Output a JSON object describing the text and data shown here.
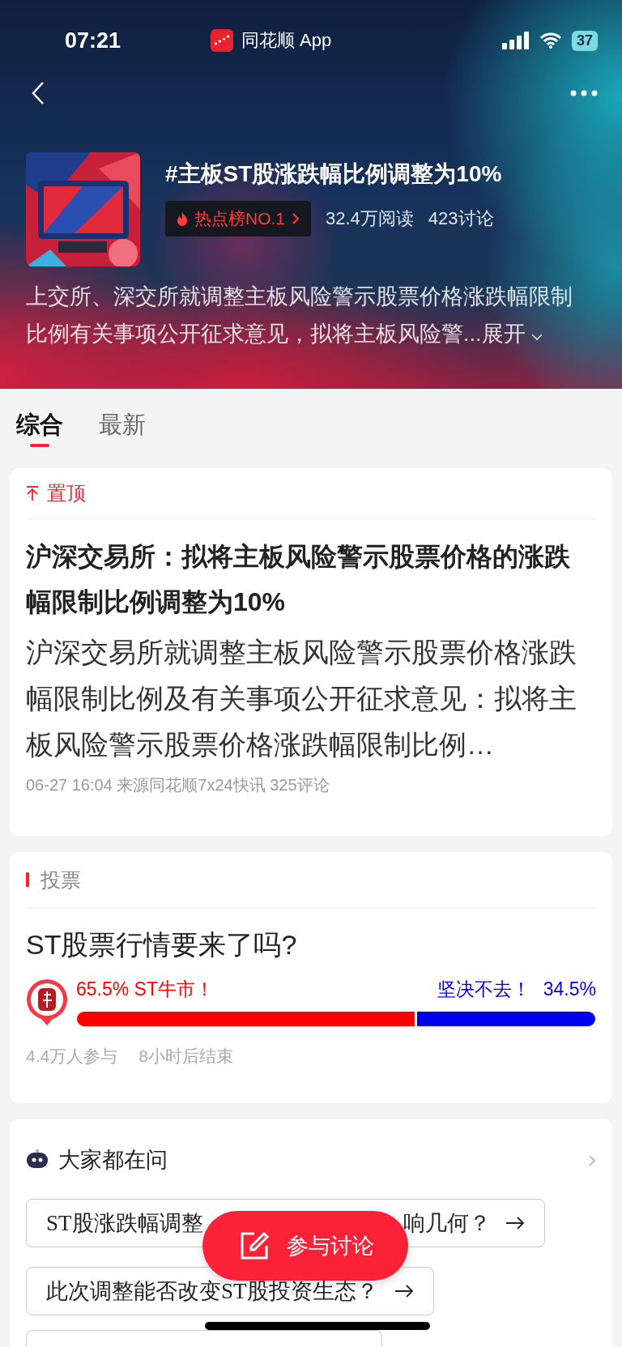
{
  "status_bar": {
    "time": "07:21",
    "app": "同花顺 App",
    "battery": "37"
  },
  "header": {
    "title": "#主板ST股涨跌幅比例调整为10%",
    "hot_badge": "热点榜NO.1",
    "reads": "32.4万阅读",
    "discussions": "423讨论",
    "description": "上交所、深交所就调整主板风险警示股票价格涨跌幅限制比例有关事项公开征求意见，拟将主板风险警...",
    "expand": "展开"
  },
  "tabs": [
    {
      "label": "综合",
      "selected": true
    },
    {
      "label": "最新",
      "selected": false
    }
  ],
  "pinned_post": {
    "pin_label": "置顶",
    "headline": "沪深交易所：拟将主板风险警示股票价格的涨跌幅限制比例调整为10%",
    "summary": "沪深交易所就调整主板风险警示股票价格涨跌幅限制比例及有关事项公开征求意见：拟将主板风险警示股票价格涨跌幅限制比例…",
    "meta": "06-27 16:04 来源同花顺7x24快讯 325评论"
  },
  "poll": {
    "section": "投票",
    "question": "ST股票行情要来了吗?",
    "options": [
      {
        "percent": "65.5%",
        "label": "ST牛市！",
        "level": 0.655,
        "color": "#ff0000"
      },
      {
        "percent": "34.5%",
        "label": "坚决不去！",
        "level": 0.345,
        "color": "#0000ee"
      }
    ],
    "participants": "4.4万人参与",
    "ends": "8小时后结束"
  },
  "ask": {
    "title": "大家都在问",
    "questions": [
      {
        "parts": [
          "ST股涨跌幅调整",
          "响几何？"
        ]
      },
      {
        "parts": [
          "此次调整能否改变ST股投资生态？"
        ]
      }
    ]
  },
  "action_button": "参与讨论"
}
